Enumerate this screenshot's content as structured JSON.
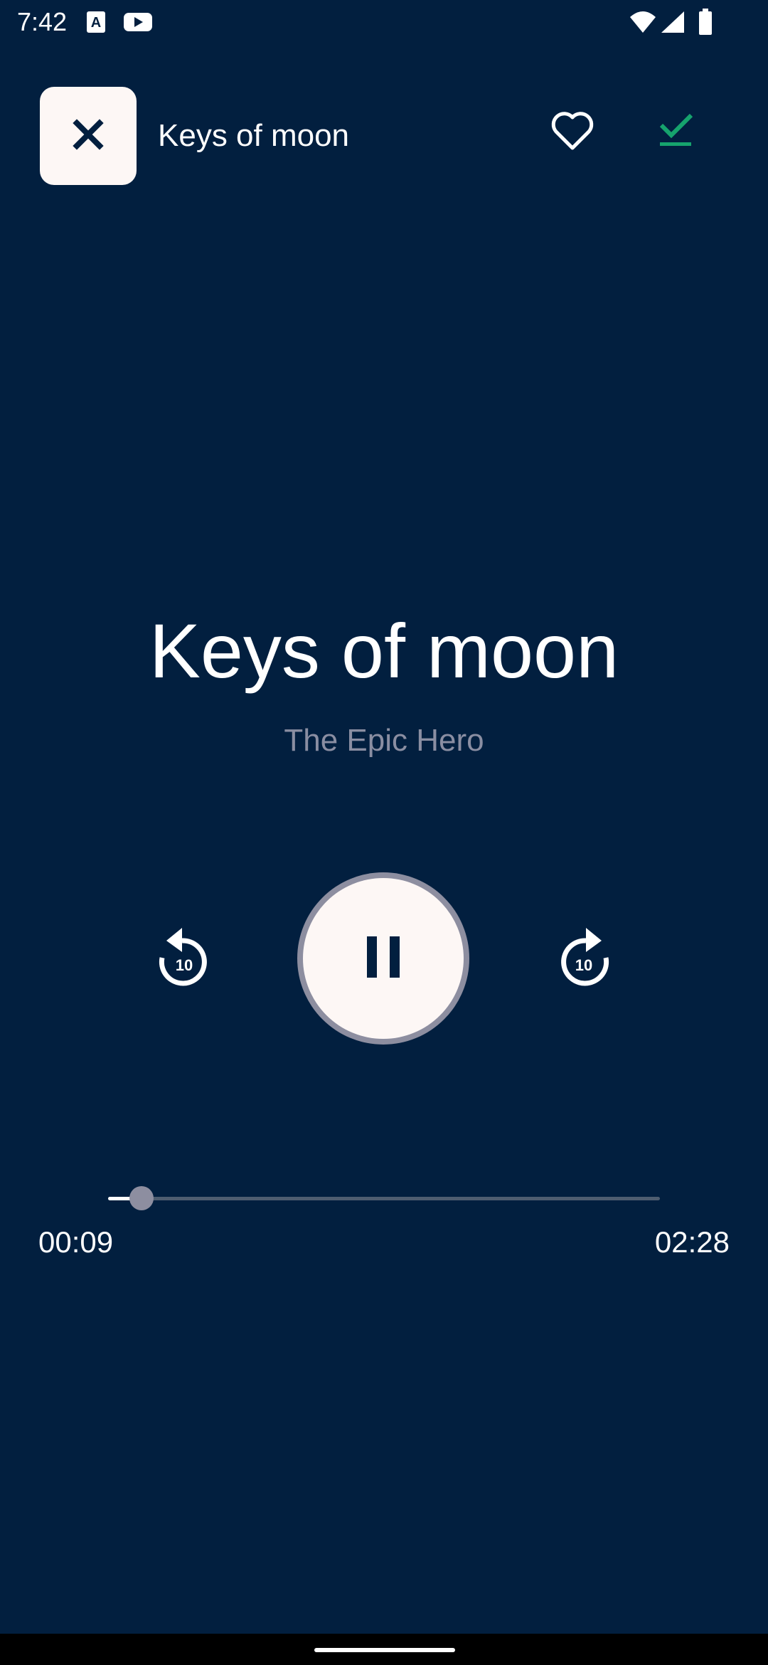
{
  "status_bar": {
    "time": "7:42",
    "icons": [
      "a-font-icon",
      "youtube-icon",
      "wifi-icon",
      "signal-icon",
      "battery-icon"
    ]
  },
  "header": {
    "title": "Keys of moon",
    "close_icon": "close-icon",
    "favorite_icon": "heart-outline-icon",
    "download_icon": "download-done-icon",
    "download_color": "#16a36d"
  },
  "track": {
    "title": "Keys of moon",
    "artist": "The Epic Hero"
  },
  "controls": {
    "rewind_label": "10",
    "forward_label": "10",
    "play_pause_icon": "pause-icon"
  },
  "progress": {
    "elapsed": "00:09",
    "total": "02:28",
    "fraction": 0.061
  },
  "colors": {
    "background": "#021f3f",
    "accent_light": "#fdf7f5",
    "muted": "#8a8ea2"
  }
}
